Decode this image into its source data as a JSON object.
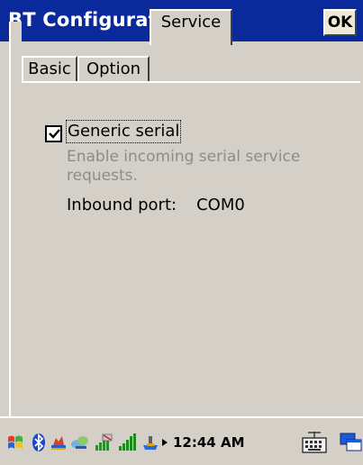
{
  "window": {
    "title": "BT Configuration",
    "ok_label": "OK"
  },
  "tabs": [
    {
      "label": "Basic",
      "active": false
    },
    {
      "label": "Option",
      "active": false
    },
    {
      "label": "Service",
      "active": true
    }
  ],
  "service": {
    "generic_serial": {
      "label": "Generic serial",
      "checked": true
    },
    "description": "Enable incoming serial service requests.",
    "inbound_port_label": "Inbound port:",
    "inbound_port_value": "COM0"
  },
  "taskbar": {
    "icons": [
      "start-flag-icon",
      "bluetooth-icon",
      "usb-icon",
      "network-icon",
      "signal-antenna-icon",
      "signal-bars-icon",
      "connection-icon",
      "arrow-right-icon"
    ],
    "clock": "12:44 AM",
    "keyboard_icon": "keyboard-icon",
    "desktop_icon": "windows-switch-icon"
  },
  "colors": {
    "titlebar": "#0a2a9c",
    "face": "#d4d0c8",
    "disabled_text": "#8c8c8c"
  }
}
